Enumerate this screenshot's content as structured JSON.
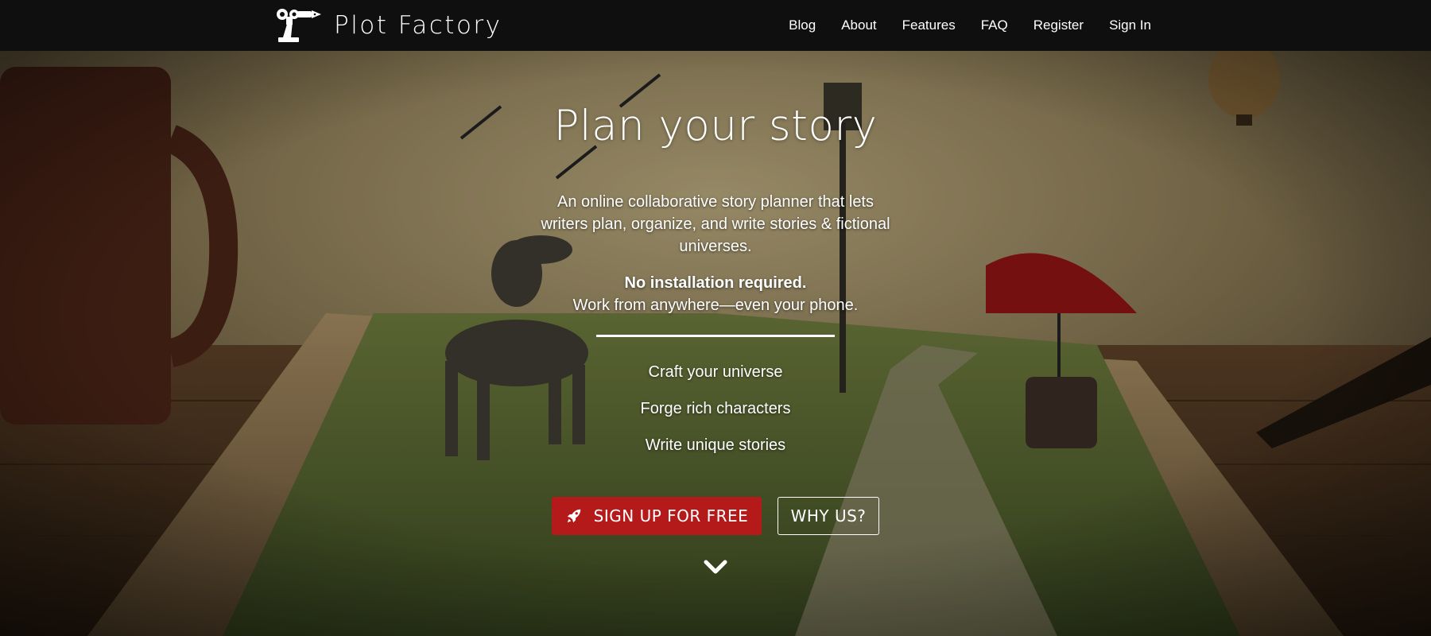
{
  "brand": {
    "name": "Plot Factory",
    "logo_icon": "robot-arm-pen-icon"
  },
  "nav": {
    "links": [
      {
        "label": "Blog"
      },
      {
        "label": "About"
      },
      {
        "label": "Features"
      },
      {
        "label": "FAQ"
      },
      {
        "label": "Register"
      },
      {
        "label": "Sign In"
      }
    ]
  },
  "hero": {
    "title": "Plan your story",
    "description": "An online collaborative story planner that lets writers plan, organize, and write stories & fictional universes.",
    "note_bold": "No installation required.",
    "note_text": "Work from anywhere—even your phone.",
    "features": [
      "Craft your universe",
      "Forge rich characters",
      "Write unique stories"
    ],
    "signup_label": "SIGN UP FOR FREE",
    "signup_icon": "rocket-icon",
    "why_label": "WHY US?",
    "scroll_icon": "chevron-down-icon"
  },
  "colors": {
    "navbar_bg": "#0f0f0f",
    "accent_red": "#b51a1a",
    "text": "#ffffff"
  }
}
